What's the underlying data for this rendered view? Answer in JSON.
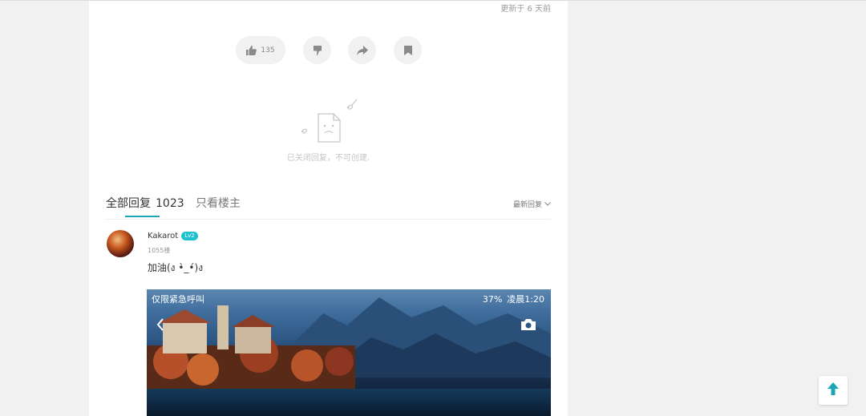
{
  "post": {
    "updated_text": "更新于 6 天前",
    "like_count": "135"
  },
  "closed_message": "已关闭回复，不可创建.",
  "tabs": {
    "all_label": "全部回复",
    "all_count": "1023",
    "op_only_label": "只看楼主",
    "sort_label": "最新回复"
  },
  "reply": {
    "username": "Kakarot",
    "level": "Lv2",
    "floor": "1055楼",
    "text": "加油(ง •̀_•́)ง",
    "image_status_left": "仅限紧急呼叫",
    "image_status_battery": "37%",
    "image_status_time": "凌晨1:20"
  },
  "colors": {
    "accent": "#1ba5b8",
    "level_badge": "#1ec0cf",
    "to_top_arrow": "#1aa6b7"
  },
  "icons": [
    "thumbs-up-icon",
    "thumbs-down-icon",
    "share-icon",
    "bookmark-icon",
    "sad-document-icon",
    "chevron-down-icon",
    "camera-icon",
    "arrow-up-icon"
  ]
}
